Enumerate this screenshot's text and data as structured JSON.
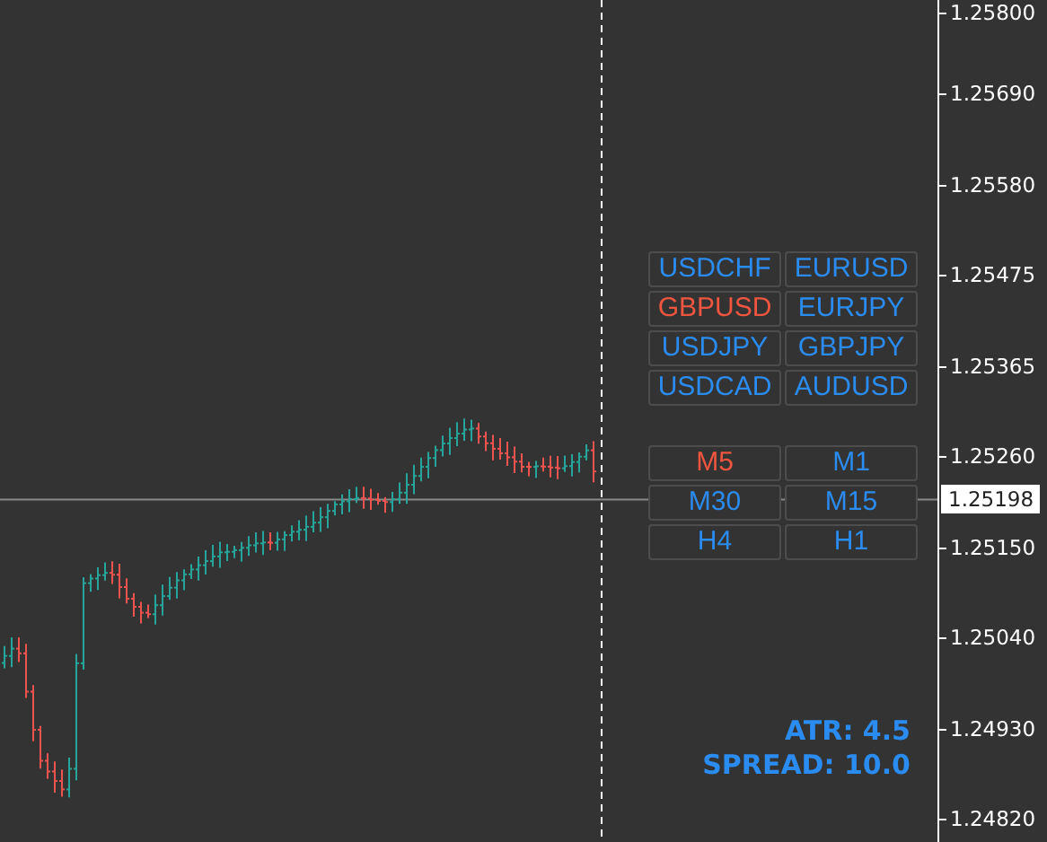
{
  "symbols": [
    {
      "label": "USDCHF",
      "selected": false
    },
    {
      "label": "EURUSD",
      "selected": false
    },
    {
      "label": "GBPUSD",
      "selected": true
    },
    {
      "label": "EURJPY",
      "selected": false
    },
    {
      "label": "USDJPY",
      "selected": false
    },
    {
      "label": "GBPJPY",
      "selected": false
    },
    {
      "label": "USDCAD",
      "selected": false
    },
    {
      "label": "AUDUSD",
      "selected": false
    }
  ],
  "timeframes": [
    {
      "label": "M5",
      "selected": true
    },
    {
      "label": "M1",
      "selected": false
    },
    {
      "label": "M30",
      "selected": false
    },
    {
      "label": "M15",
      "selected": false
    },
    {
      "label": "H4",
      "selected": false
    },
    {
      "label": "H1",
      "selected": false
    }
  ],
  "price_axis": [
    "1.25800",
    "1.25690",
    "1.25580",
    "1.25475",
    "1.25365",
    "1.25260",
    "1.25150",
    "1.25040",
    "1.24930",
    "1.24820"
  ],
  "current_price": "1.25198",
  "indicators": [
    "ATR: 4.5",
    "SPREAD: 10.0"
  ]
}
